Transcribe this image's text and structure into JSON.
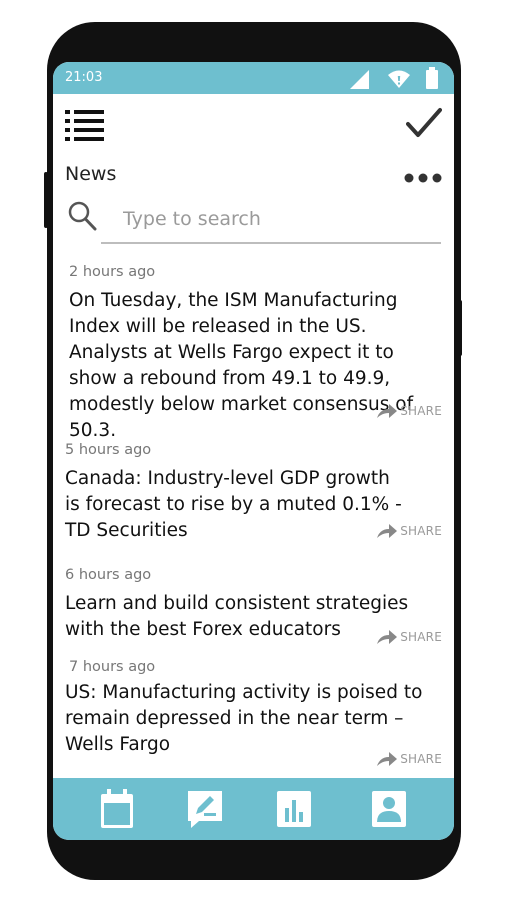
{
  "status_bar": {
    "time": "21:03",
    "icons": [
      "signal-icon",
      "wifi-icon",
      "battery-icon"
    ]
  },
  "toolbar": {
    "menu_icon": "list-menu-icon",
    "confirm_icon": "checkmark-icon"
  },
  "section": {
    "title": "News",
    "more_icon": "more-dots-icon"
  },
  "search": {
    "placeholder": "Type to search",
    "value": ""
  },
  "news": [
    {
      "time": "2 hours ago",
      "text": "On Tuesday, the ISM Manufacturing Index will be released in the US. Analysts at Wells Fargo expect it to show a rebound from 49.1 to 49.9, modestly below market consensus of 50.3.",
      "share": "SHARE"
    },
    {
      "time": "5 hours ago",
      "text": "Canada: Industry-level GDP growth is forecast to rise by a muted 0.1% - TD Securities",
      "share": "SHARE"
    },
    {
      "time": "6 hours ago",
      "text": "Learn and build consistent strategies with the best Forex educators",
      "share": "SHARE"
    },
    {
      "time": "7 hours ago",
      "text": "US: Manufacturing activity is poised to remain depressed in the near term – Wells Fargo",
      "share": "SHARE"
    }
  ],
  "bottom_nav": {
    "icons": [
      "calendar-icon",
      "edit-icon",
      "chart-icon",
      "profile-icon"
    ]
  },
  "colors": {
    "accent": "#6ebfcf",
    "frame": "#111111",
    "text": "#111111",
    "muted": "#777777"
  }
}
